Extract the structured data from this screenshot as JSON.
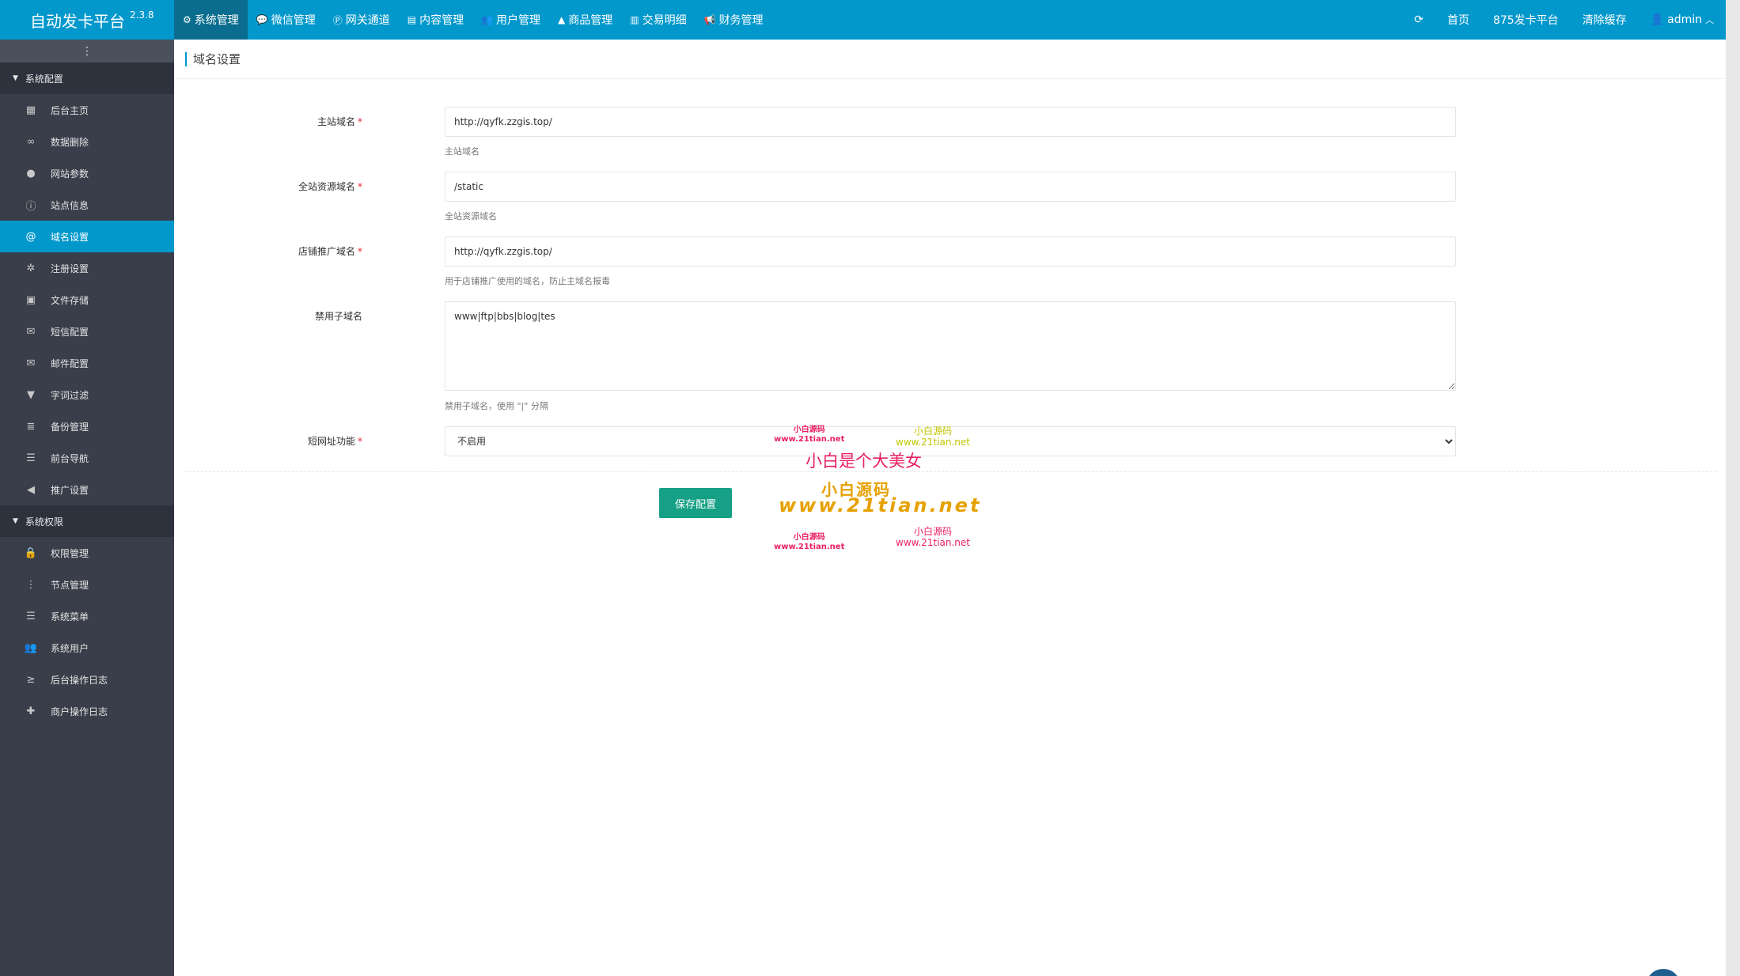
{
  "app": {
    "name": "自动发卡平台",
    "version": "2.3.8"
  },
  "topnav": [
    {
      "label": "系统管理",
      "icon": "gear-icon",
      "glyph": "⚙",
      "active": true
    },
    {
      "label": "微信管理",
      "icon": "wechat-icon",
      "glyph": "💬",
      "active": false
    },
    {
      "label": "网关通道",
      "icon": "paypal-icon",
      "glyph": "Ⓟ",
      "active": false
    },
    {
      "label": "内容管理",
      "icon": "file-icon",
      "glyph": "▤",
      "active": false
    },
    {
      "label": "用户管理",
      "icon": "users-icon",
      "glyph": "👥",
      "active": false
    },
    {
      "label": "商品管理",
      "icon": "bag-icon",
      "glyph": "▲",
      "active": false
    },
    {
      "label": "交易明细",
      "icon": "bar-chart-icon",
      "glyph": "▥",
      "active": false
    },
    {
      "label": "财务管理",
      "icon": "bullhorn-icon",
      "glyph": "📢",
      "active": false
    }
  ],
  "topright": {
    "refresh_glyph": "⟳",
    "home": "首页",
    "platform": "875发卡平台",
    "clear_cache": "清除缓存",
    "user": "admin"
  },
  "sidebar": {
    "toggle_glyph": "⋮",
    "groups": [
      {
        "title": "系统配置",
        "items": [
          {
            "label": "后台主页",
            "icon": "area-chart-icon",
            "glyph": "▦",
            "active": false
          },
          {
            "label": "数据删除",
            "icon": "link-icon",
            "glyph": "∞",
            "active": false
          },
          {
            "label": "网站参数",
            "icon": "apple-icon",
            "glyph": "●",
            "active": false
          },
          {
            "label": "站点信息",
            "icon": "info-icon",
            "glyph": "ⓘ",
            "active": false
          },
          {
            "label": "域名设置",
            "icon": "at-icon",
            "glyph": "@",
            "active": true
          },
          {
            "label": "注册设置",
            "icon": "cog-icon",
            "glyph": "✲",
            "active": false
          },
          {
            "label": "文件存储",
            "icon": "save-icon",
            "glyph": "▣",
            "active": false
          },
          {
            "label": "短信配置",
            "icon": "envelope-icon",
            "glyph": "✉",
            "active": false
          },
          {
            "label": "邮件配置",
            "icon": "envelope-icon",
            "glyph": "✉",
            "active": false
          },
          {
            "label": "字词过滤",
            "icon": "filter-icon",
            "glyph": "▼",
            "active": false
          },
          {
            "label": "备份管理",
            "icon": "database-icon",
            "glyph": "≣",
            "active": false
          },
          {
            "label": "前台导航",
            "icon": "bars-icon",
            "glyph": "☰",
            "active": false
          },
          {
            "label": "推广设置",
            "icon": "bullhorn-icon",
            "glyph": "◀",
            "active": false
          }
        ]
      },
      {
        "title": "系统权限",
        "items": [
          {
            "label": "权限管理",
            "icon": "lock-icon",
            "glyph": "🔒",
            "active": false
          },
          {
            "label": "节点管理",
            "icon": "ellipsis-vertical-icon",
            "glyph": "⋮",
            "active": false
          },
          {
            "label": "系统菜单",
            "icon": "bars-icon",
            "glyph": "☰",
            "active": false
          },
          {
            "label": "系统用户",
            "icon": "users-icon",
            "glyph": "👥",
            "active": false
          },
          {
            "label": "后台操作日志",
            "icon": "terminal-icon",
            "glyph": "≥",
            "active": false
          },
          {
            "label": "商户操作日志",
            "icon": "thumbtack-icon",
            "glyph": "✚",
            "active": false
          }
        ]
      }
    ]
  },
  "page": {
    "title": "域名设置"
  },
  "form": {
    "main_domain": {
      "label": "主站域名",
      "value": "http://qyfk.zzgis.top/",
      "help": "主站域名",
      "required": "*"
    },
    "static_domain": {
      "label": "全站资源域名",
      "value": "/static",
      "help": "全站资源域名",
      "required": "*"
    },
    "shop_domain": {
      "label": "店铺推广域名",
      "value": "http://qyfk.zzgis.top/",
      "help": "用于店铺推广使用的域名，防止主域名报毒",
      "required": "*"
    },
    "forbidden_sub": {
      "label": "禁用子域名",
      "value": "www|ftp|bbs|blog|tes",
      "help": "禁用子域名，使用 \"|\" 分隔"
    },
    "short_url": {
      "label": "短网址功能",
      "value": "不启用",
      "required": "*"
    },
    "save_label": "保存配置"
  },
  "watermark": {
    "small_cn_1": "小白源码",
    "small_url_1": "www.21tian.net",
    "yellow_cn_1": "小白源码",
    "yellow_url_1": "www.21tian.net",
    "big_cn": "小白是个大美女",
    "orange_cn": "小白源码",
    "orange_url": "www.21tian.net",
    "small_cn_2": "小白源码",
    "small_url_2": "www.21tian.net",
    "pink_cn_2": "小白源码",
    "pink_url_2": "www.21tian.net"
  }
}
